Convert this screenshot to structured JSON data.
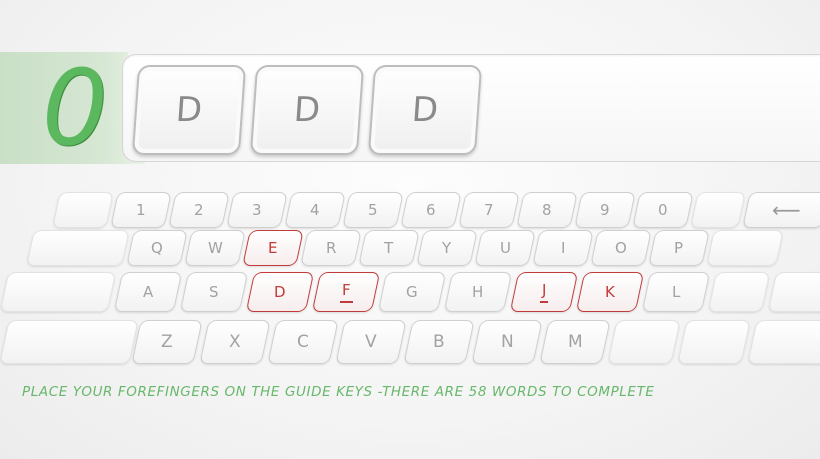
{
  "score": "0",
  "word_tiles": [
    "D",
    "D",
    "D"
  ],
  "keyboard": {
    "row1": [
      "1",
      "2",
      "3",
      "4",
      "5",
      "6",
      "7",
      "8",
      "9",
      "0"
    ],
    "backspace": "⟵",
    "row2": [
      "Q",
      "W",
      "E",
      "R",
      "T",
      "Y",
      "U",
      "I",
      "O",
      "P"
    ],
    "row3": [
      "A",
      "S",
      "D",
      "F",
      "G",
      "H",
      "J",
      "K",
      "L"
    ],
    "row4": [
      "Z",
      "X",
      "C",
      "V",
      "B",
      "N",
      "M"
    ]
  },
  "highlighted_keys": [
    "E",
    "D",
    "F",
    "J",
    "K"
  ],
  "guide_keys": [
    "F",
    "J"
  ],
  "instruction": "PLACE YOUR FOREFINGERS ON THE GUIDE KEYS -THERE ARE 58 WORDS TO COMPLETE",
  "colors": {
    "accent_green": "#5cb85f",
    "highlight_red": "#c23b3b"
  }
}
